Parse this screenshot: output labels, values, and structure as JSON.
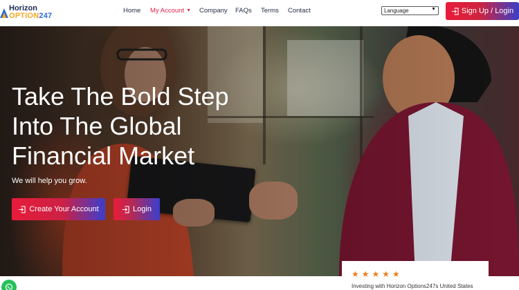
{
  "brand": {
    "line1": "Horizon",
    "line2_text": "OPTION",
    "line2_num": "247"
  },
  "nav": {
    "items": [
      {
        "label": "Home"
      },
      {
        "label": "My Account"
      },
      {
        "label": "Company"
      },
      {
        "label": "FAQs"
      },
      {
        "label": "Terms"
      },
      {
        "label": "Contact"
      }
    ]
  },
  "language": {
    "selected": "Language"
  },
  "header": {
    "signup_label": "Sign Up / Login"
  },
  "hero": {
    "headline": [
      "Take The Bold Step",
      "Into The Global",
      "Financial Market"
    ],
    "subtext": "We will help you grow.",
    "create_label": "Create Your Account",
    "login_label": "Login"
  },
  "review": {
    "stars": "★★★★★",
    "text": "Investing with Horizon Options247s United States"
  },
  "colors": {
    "accent_red": "#e81c3a",
    "accent_blue": "#3a3ed0",
    "star": "#f07d1a",
    "whatsapp": "#25c15b"
  }
}
